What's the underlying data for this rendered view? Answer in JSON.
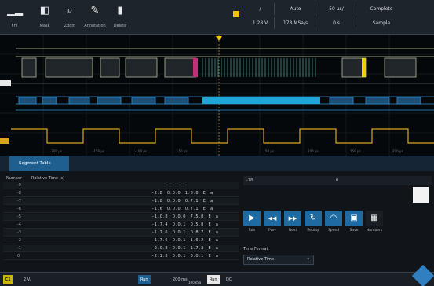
{
  "toolbar": {
    "tools": [
      {
        "icon": "waveform-icon",
        "glyph": "▁▂",
        "label": "FFT"
      },
      {
        "icon": "mask-icon",
        "glyph": "◧",
        "label": "Mask"
      },
      {
        "icon": "zoom-icon",
        "glyph": "⌕",
        "label": "Zoom"
      },
      {
        "icon": "annotation-icon",
        "glyph": "✎",
        "label": "Annotation"
      },
      {
        "icon": "delete-icon",
        "glyph": "▮",
        "label": "Delete"
      }
    ]
  },
  "trigger": {
    "channel_color": "#f3c400",
    "slope": "/",
    "level": "1.28 V",
    "mode": "Auto",
    "time_scale": "50 µs/",
    "sample_rate": "178 MSa/s",
    "offset": "0 s",
    "status": "Complete",
    "acq_mode": "Sample"
  },
  "split": {
    "tab_label": "Segment Table"
  },
  "segment_table": {
    "headers": [
      "Number",
      "Relative Time (s)"
    ],
    "rows": [
      {
        "num": "-9",
        "data": "       -  -  -  -"
      },
      {
        "num": "-8",
        "data": "-2.8  0.0.0  1.8.8  E  a"
      },
      {
        "num": "-7",
        "data": "-1.8  0.0.0  0.7.1  E  a"
      },
      {
        "num": "-6",
        "data": "-1.6  0.0.0  0.7.1  E  a"
      },
      {
        "num": "-5",
        "data": "-1.0.8  0.0.0  7.5.8  E  a"
      },
      {
        "num": "-4",
        "data": "-1.7.4  0.0.1  0.5.8  E  a"
      },
      {
        "num": "-3",
        "data": "-1.7.6  0.0.1  0.8.7  E  a"
      },
      {
        "num": "-2",
        "data": "-1.7.6  0.0.1  1.6.2  E  a"
      },
      {
        "num": "-1",
        "data": "-2.0.8  0.0.1  1.7.3  E  a"
      },
      {
        "num": "0",
        "data": "-2.1.8  0.0.1  0.0.1  E  a"
      }
    ]
  },
  "playback": {
    "header_left": "-18",
    "header_mid": "0",
    "buttons": [
      {
        "icon": "play-icon",
        "glyph": "▶",
        "label": "Run"
      },
      {
        "icon": "rewind-icon",
        "glyph": "◀◀",
        "label": "Prev"
      },
      {
        "icon": "forward-icon",
        "glyph": "▶▶",
        "label": "Next"
      },
      {
        "icon": "replay-icon",
        "glyph": "↻",
        "label": "Replay"
      },
      {
        "icon": "speed-icon",
        "glyph": "◠",
        "label": "Speed"
      },
      {
        "icon": "save-icon",
        "glyph": "▣",
        "label": "Save"
      },
      {
        "icon": "grid-icon",
        "glyph": "▦",
        "label": "Numbers"
      }
    ],
    "time_format_label": "Time Format",
    "time_format_value": "Relative Time"
  },
  "status_bar": {
    "ch1": "C1",
    "ch1_value": "2 V/",
    "trig": "Run",
    "timebase": "200 ms",
    "acq": "100 kSa",
    "mode": "Run",
    "mode2": "DC"
  }
}
